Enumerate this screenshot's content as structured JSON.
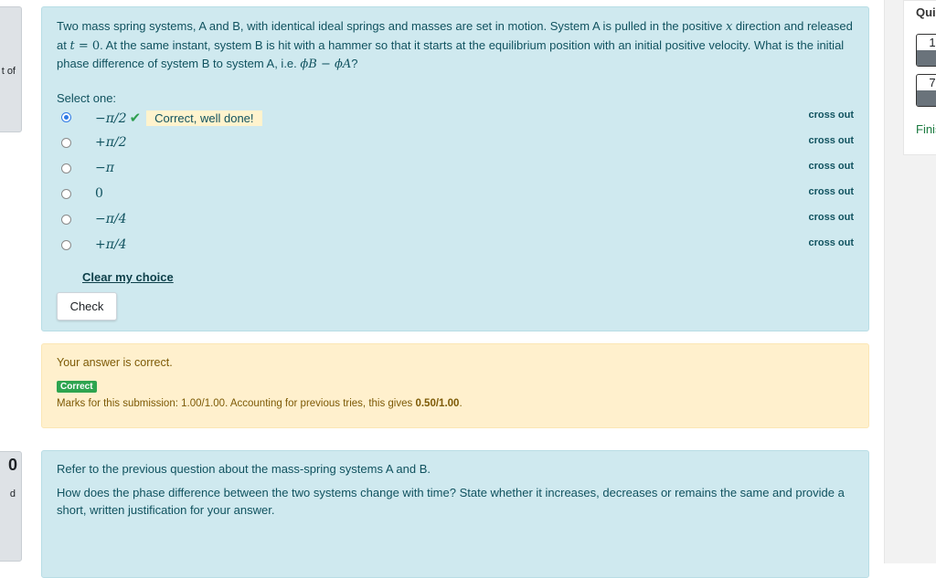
{
  "left_info": {
    "top_text": "t of",
    "bottom_number": "0",
    "bottom_text": "d"
  },
  "question1": {
    "text_parts": {
      "p1": "Two mass spring systems, A and B, with identical ideal springs and masses are set in motion. System A is pulled in the positive ",
      "var_x": "x",
      "p2": " direction and released at ",
      "var_t": "t",
      "eq": " = 0",
      "p3": ". At the same instant, system B is hit with a hammer so that it starts at the equilibrium position with an initial positive velocity. What is the initial phase difference of system B to system A, i.e. ",
      "phi_expr": "ϕB − ϕA",
      "p4": "?"
    },
    "select_label": "Select one:",
    "options": [
      {
        "label": "−π/2",
        "checked": true,
        "cross_out": "cross out"
      },
      {
        "label": "+π/2",
        "checked": false,
        "cross_out": "cross out"
      },
      {
        "label": "−π",
        "checked": false,
        "cross_out": "cross out"
      },
      {
        "label": "0",
        "checked": false,
        "cross_out": "cross out"
      },
      {
        "label": "−π/4",
        "checked": false,
        "cross_out": "cross out"
      },
      {
        "label": "+π/4",
        "checked": false,
        "cross_out": "cross out"
      }
    ],
    "option_feedback": "Correct, well done!",
    "clear_choice": "Clear my choice",
    "check_button": "Check"
  },
  "outcome": {
    "result_text": "Your answer is correct.",
    "badge": "Correct",
    "marks_prefix": "Marks for this submission: 1.00/1.00. Accounting for previous tries, this gives ",
    "marks_bold": "0.50/1.00",
    "marks_suffix": "."
  },
  "question2": {
    "line1": "Refer to the previous question about the mass-spring systems A and B.",
    "line2": "How does the phase difference between the two systems change with time? State whether it increases, decreases or remains the same and provide a short, written justification for your answer."
  },
  "quiz_nav": {
    "title": "Quiz navigation",
    "buttons": [
      "1",
      "7"
    ],
    "finish": "Finish attempt ..."
  },
  "colors": {
    "info_bg": "#cfe9ef",
    "info_text": "#10525f",
    "outcome_bg": "#fff0cd",
    "success": "#2ea44f"
  }
}
